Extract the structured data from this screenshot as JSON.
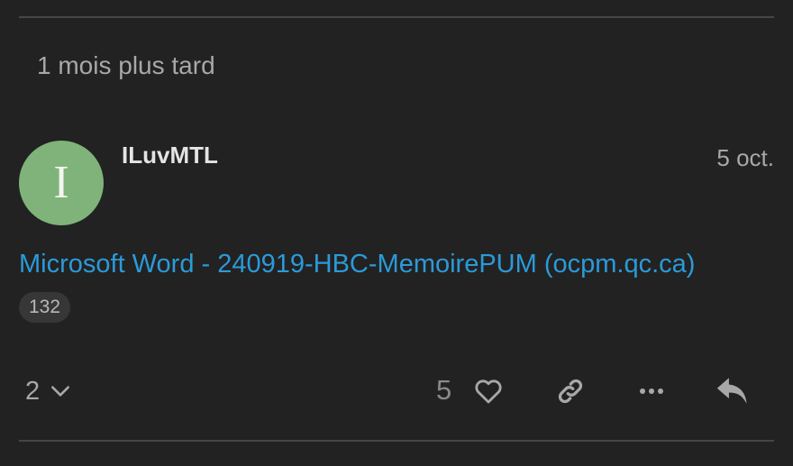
{
  "time_gap": {
    "label": "1 mois plus tard"
  },
  "post": {
    "author": {
      "username": "ILuvMTL",
      "avatar_letter": "I",
      "avatar_color": "#7fb37a"
    },
    "date": "5 oct.",
    "link": {
      "text": "Microsoft Word - 240919-HBC-MemoirePUM (ocpm.qc.ca)",
      "color": "#2b9ad8"
    },
    "click_count": "132"
  },
  "actions": {
    "replies_count": "2",
    "like_count": "5",
    "icons": {
      "replies_toggle": "chevron-down-icon",
      "like": "heart-icon",
      "copy_link": "link-icon",
      "more": "more-horizontal-icon",
      "reply": "reply-icon"
    }
  }
}
